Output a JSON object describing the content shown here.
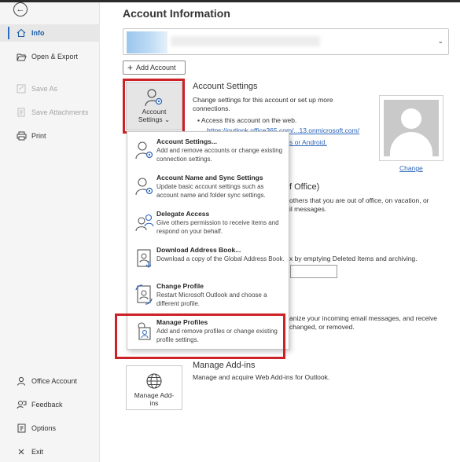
{
  "sidebar": {
    "items": [
      {
        "label": "Info",
        "icon": "home-icon",
        "active": true
      },
      {
        "label": "Open & Export",
        "icon": "folder-open-icon"
      },
      {
        "label": "Save As",
        "icon": "save-as-icon",
        "disabled": true
      },
      {
        "label": "Save Attachments",
        "icon": "save-attachments-icon",
        "disabled": true
      },
      {
        "label": "Print",
        "icon": "printer-icon"
      },
      {
        "label": "Office Account",
        "icon": "person-icon"
      },
      {
        "label": "Feedback",
        "icon": "feedback-icon"
      },
      {
        "label": "Options",
        "icon": "options-icon"
      },
      {
        "label": "Exit",
        "icon": "close-icon"
      }
    ]
  },
  "header": {
    "title": "Account Information"
  },
  "account_selector": {
    "chevron": "⌄"
  },
  "add_account": {
    "label": "Add Account"
  },
  "account_settings": {
    "button_line1": "Account",
    "button_line2": "Settings",
    "button_chevron": "⌄",
    "title": "Account Settings",
    "description": "Change settings for this account or set up more connections.",
    "bullet": "Access this account on the web.",
    "link1": "https://outlook.office365.com/...13.onmicrosoft.com/",
    "link2": "s or Android."
  },
  "profile_picture": {
    "change_label": "Change"
  },
  "auto_replies": {
    "title_fragment": "f Office)",
    "text_line1": "others that you are out of office, on vacation, or",
    "text_line2": "il messages."
  },
  "cleanup": {
    "text": "x by emptying Deleted Items and archiving."
  },
  "rules": {
    "text_line1": "anize your incoming email messages, and receive",
    "text_line2": "changed, or removed."
  },
  "manage_addins": {
    "button_line1": "Manage Add-",
    "button_line2": "ins",
    "title": "Manage Add-ins",
    "description": "Manage and acquire Web Add-ins for Outlook."
  },
  "dropdown": {
    "items": [
      {
        "title": "Account Settings...",
        "desc": "Add and remove accounts or change existing connection settings."
      },
      {
        "title": "Account Name and Sync Settings",
        "desc": "Update basic account settings such as account name and folder sync settings."
      },
      {
        "title": "Delegate Access",
        "desc": "Give others permission to receive items and respond on your behalf."
      },
      {
        "title": "Download Address Book...",
        "desc": "Download a copy of the Global Address Book."
      },
      {
        "title": "Change Profile",
        "desc": "Restart Microsoft Outlook and choose a different profile."
      },
      {
        "title": "Manage Profiles",
        "desc": "Add and remove profiles or change existing profile settings."
      }
    ]
  },
  "colors": {
    "highlight_box": "#cc2127",
    "link": "#2b64b8",
    "active_nav": "#1a5ea8"
  }
}
